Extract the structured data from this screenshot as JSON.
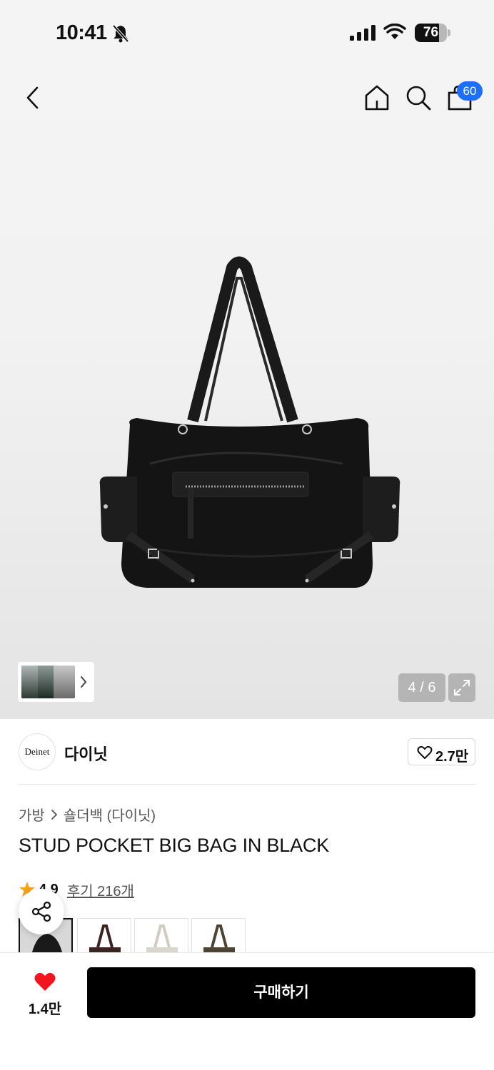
{
  "status_bar": {
    "time": "10:41",
    "battery": "76",
    "battery_level": 0.76
  },
  "header": {
    "cart_count": "60",
    "icons": [
      "back-icon",
      "home-icon",
      "search-icon",
      "cart-icon"
    ]
  },
  "gallery": {
    "pager": "4 / 6",
    "current_index": 4,
    "total": 6
  },
  "brand": {
    "logo_text": "Deinet",
    "name": "다이닛",
    "likes": "2.7만"
  },
  "product": {
    "breadcrumb": [
      "가방",
      "숄더백 (다이닛)"
    ],
    "title": "STUD POCKET BIG BAG IN BLACK",
    "rating": "4.9",
    "reviews": "후기 216개"
  },
  "swatches": [
    {
      "color": "#1a1a1a",
      "selected": true
    },
    {
      "color": "#3a2421",
      "selected": false
    },
    {
      "color": "#d9d6cd",
      "selected": false
    },
    {
      "color": "#4d4435",
      "selected": false
    }
  ],
  "bottom_bar": {
    "wish_count": "1.4만",
    "buy_label": "구매하기"
  },
  "colors": {
    "badge": "#1f6fff",
    "heart": "#f2141e",
    "star": "#f7a21a"
  }
}
